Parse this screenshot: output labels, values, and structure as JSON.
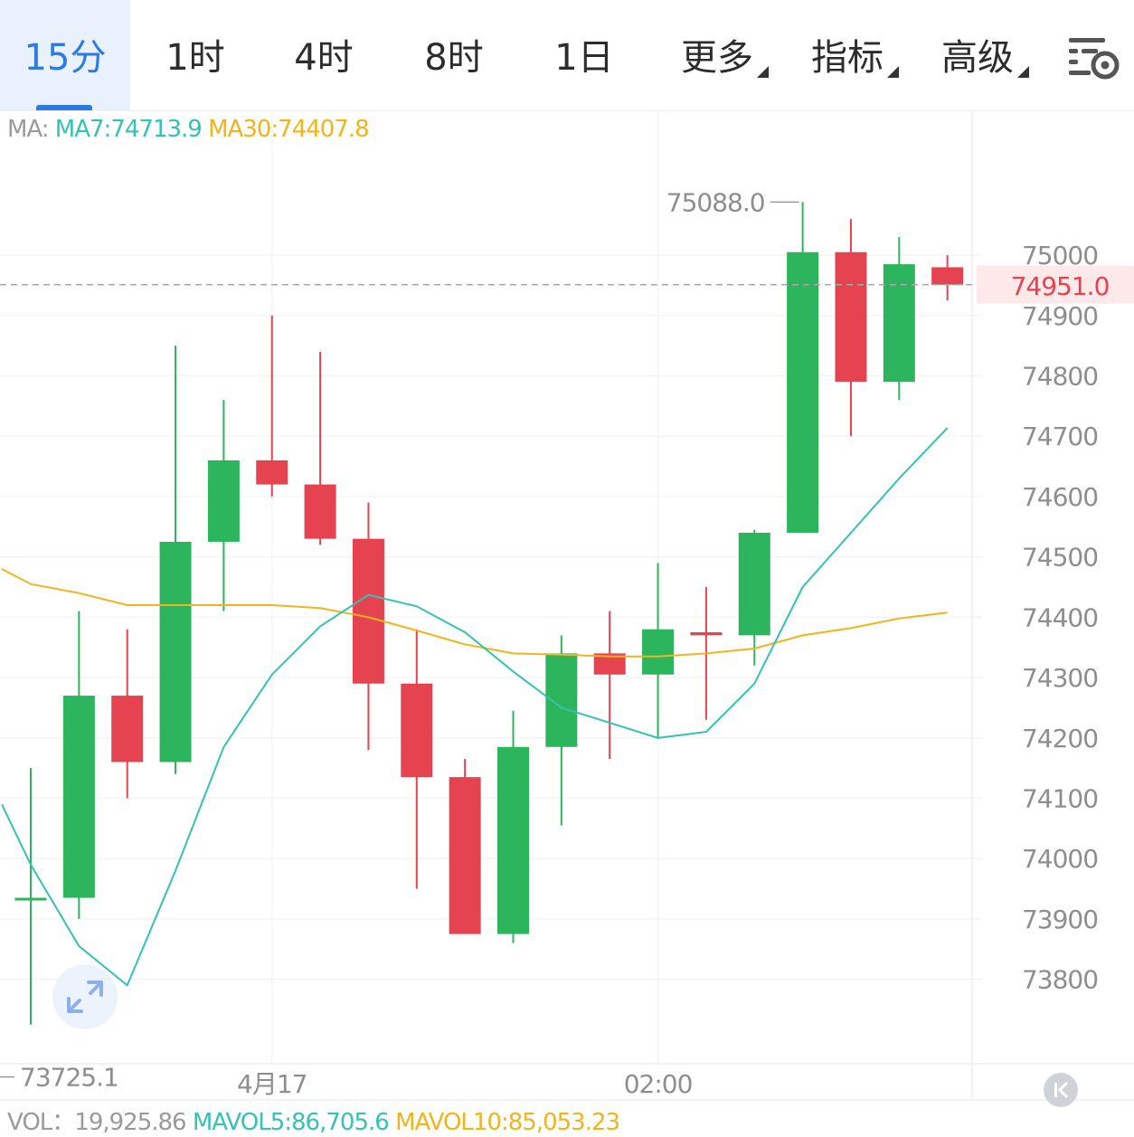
{
  "tabs": [
    {
      "label": "15分",
      "active": true
    },
    {
      "label": "1时"
    },
    {
      "label": "4时"
    },
    {
      "label": "8时"
    },
    {
      "label": "1日"
    },
    {
      "label": "更多",
      "dropdown": true
    },
    {
      "label": "指标",
      "dropdown": true
    },
    {
      "label": "高级",
      "dropdown": true
    }
  ],
  "ma_legend": {
    "prefix": "MA:",
    "ma7": "MA7:74713.9",
    "ma30": "MA30:74407.8"
  },
  "vol_legend": {
    "vol": "VOL：19,925.86",
    "mavol5": "MAVOL5:86,705.6",
    "mavol10": "MAVOL10:85,053.23"
  },
  "expand_icon": "expand-arrows-icon",
  "back_icon": "collapse-left-icon",
  "colors": {
    "up": "#2db55d",
    "down": "#e5434f",
    "ma7": "#35c2b3",
    "ma30": "#f0b41e",
    "price_tag": "#e5434f",
    "active_tab": "#2c7be5"
  },
  "chart_data": {
    "type": "candlestick",
    "y_ticks": [
      75000,
      74900,
      74800,
      74700,
      74600,
      74500,
      74400,
      74300,
      74200,
      74100,
      74000,
      73900,
      73800
    ],
    "ylim": [
      73660,
      75240
    ],
    "x_labels": [
      {
        "label": "4月17",
        "index": 5
      },
      {
        "label": "02:00",
        "index": 13
      }
    ],
    "current_price": "74951.0",
    "high_label": "75088.0",
    "low_label": "73725.1",
    "candles": [
      {
        "o": 73935,
        "h": 74150,
        "l": 73725.1,
        "c": 73935
      },
      {
        "o": 73935,
        "h": 74410,
        "l": 73900,
        "c": 74270
      },
      {
        "o": 74270,
        "h": 74380,
        "l": 74100,
        "c": 74160
      },
      {
        "o": 74160,
        "h": 74850,
        "l": 74140,
        "c": 74525
      },
      {
        "o": 74525,
        "h": 74760,
        "l": 74410,
        "c": 74660
      },
      {
        "o": 74660,
        "h": 74900,
        "l": 74600,
        "c": 74620
      },
      {
        "o": 74620,
        "h": 74840,
        "l": 74520,
        "c": 74530
      },
      {
        "o": 74530,
        "h": 74590,
        "l": 74180,
        "c": 74290
      },
      {
        "o": 74290,
        "h": 74380,
        "l": 73950,
        "c": 74135
      },
      {
        "o": 74135,
        "h": 74165,
        "l": 73900,
        "c": 73875
      },
      {
        "o": 73875,
        "h": 74245,
        "l": 73860,
        "c": 74185
      },
      {
        "o": 74185,
        "h": 74370,
        "l": 74055,
        "c": 74340
      },
      {
        "o": 74340,
        "h": 74410,
        "l": 74165,
        "c": 74305
      },
      {
        "o": 74305,
        "h": 74490,
        "l": 74200,
        "c": 74380
      },
      {
        "o": 74375,
        "h": 74450,
        "l": 74230,
        "c": 74370
      },
      {
        "o": 74370,
        "h": 74545,
        "l": 74320,
        "c": 74540
      },
      {
        "o": 74540,
        "h": 75088,
        "l": 74540,
        "c": 75005
      },
      {
        "o": 75005,
        "h": 75060,
        "l": 74700,
        "c": 74790
      },
      {
        "o": 74790,
        "h": 75030,
        "l": 74760,
        "c": 74985
      },
      {
        "o": 74980,
        "h": 75000,
        "l": 74925,
        "c": 74951
      }
    ],
    "ma7": [
      {
        "i": -0.6,
        "v": 74090
      },
      {
        "i": 0.0,
        "v": 73990
      },
      {
        "i": 1.0,
        "v": 73855
      },
      {
        "i": 2.0,
        "v": 73790
      },
      {
        "i": 3.0,
        "v": 73980
      },
      {
        "i": 4.0,
        "v": 74185
      },
      {
        "i": 5.0,
        "v": 74305
      },
      {
        "i": 6.0,
        "v": 74385
      },
      {
        "i": 7.0,
        "v": 74437
      },
      {
        "i": 8.0,
        "v": 74418
      },
      {
        "i": 9.0,
        "v": 74375
      },
      {
        "i": 10.0,
        "v": 74310
      },
      {
        "i": 11.0,
        "v": 74250
      },
      {
        "i": 12.0,
        "v": 74225
      },
      {
        "i": 13.0,
        "v": 74200
      },
      {
        "i": 14.0,
        "v": 74210
      },
      {
        "i": 15.0,
        "v": 74290
      },
      {
        "i": 16.0,
        "v": 74450
      },
      {
        "i": 17.0,
        "v": 74540
      },
      {
        "i": 18.0,
        "v": 74630
      },
      {
        "i": 19.0,
        "v": 74713.9
      }
    ],
    "ma30": [
      {
        "i": -0.6,
        "v": 74480
      },
      {
        "i": 0.0,
        "v": 74455
      },
      {
        "i": 1.0,
        "v": 74440
      },
      {
        "i": 2.0,
        "v": 74420
      },
      {
        "i": 3.0,
        "v": 74420
      },
      {
        "i": 4.0,
        "v": 74420
      },
      {
        "i": 5.0,
        "v": 74420
      },
      {
        "i": 6.0,
        "v": 74415
      },
      {
        "i": 7.0,
        "v": 74400
      },
      {
        "i": 8.0,
        "v": 74378
      },
      {
        "i": 9.0,
        "v": 74355
      },
      {
        "i": 10.0,
        "v": 74340
      },
      {
        "i": 11.0,
        "v": 74338
      },
      {
        "i": 12.0,
        "v": 74335
      },
      {
        "i": 13.0,
        "v": 74335
      },
      {
        "i": 14.0,
        "v": 74340
      },
      {
        "i": 15.0,
        "v": 74348
      },
      {
        "i": 16.0,
        "v": 74370
      },
      {
        "i": 17.0,
        "v": 74382
      },
      {
        "i": 18.0,
        "v": 74398
      },
      {
        "i": 19.0,
        "v": 74407.8
      }
    ]
  }
}
